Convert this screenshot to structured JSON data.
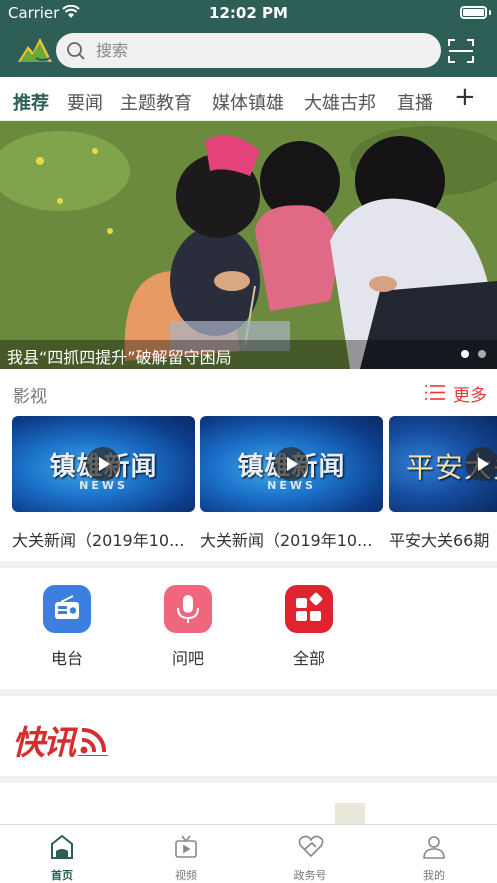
{
  "status_bar": {
    "carrier": "Carrier",
    "time": "12:02 PM"
  },
  "header": {
    "search_placeholder": "搜索",
    "logo_icon": "mountain-logo-icon",
    "scan_icon": "scan-icon",
    "color": "#2e5f57"
  },
  "tabs": [
    {
      "label": "推荐",
      "active": true
    },
    {
      "label": "要闻"
    },
    {
      "label": "主题教育"
    },
    {
      "label": "媒体镇雄"
    },
    {
      "label": "大雄古邦"
    },
    {
      "label": "直播"
    }
  ],
  "tabs_add": "+",
  "banner": {
    "caption": "我县“四抓四提升”破解留守困局"
  },
  "video_section": {
    "title": "影视",
    "more": "更多",
    "items": [
      {
        "label": "大关新闻（2019年10...",
        "thumb_title": "镇雄新闻",
        "thumb_sub": "NEWS"
      },
      {
        "label": "大关新闻（2019年10...",
        "thumb_title": "镇雄新闻",
        "thumb_sub": "NEWS"
      },
      {
        "label": "平安大关66期",
        "thumb_title": "平安大关",
        "thumb_sub": ""
      }
    ]
  },
  "quick": [
    {
      "label": "电台",
      "icon": "radio-icon",
      "color": "#3d7fe0"
    },
    {
      "label": "问吧",
      "icon": "microphone-icon",
      "color": "#f0677d"
    },
    {
      "label": "全部",
      "icon": "apps-grid-icon",
      "color": "#e0242f"
    }
  ],
  "kuaixun": {
    "text": "快讯",
    "icon": "broadcast-icon",
    "color": "#d32f2f"
  },
  "tabbar": [
    {
      "label": "首页",
      "icon": "home-icon",
      "active": true
    },
    {
      "label": "视频",
      "icon": "tv-icon"
    },
    {
      "label": "政务号",
      "icon": "heart-hands-icon"
    },
    {
      "label": "我的",
      "icon": "person-icon"
    }
  ]
}
